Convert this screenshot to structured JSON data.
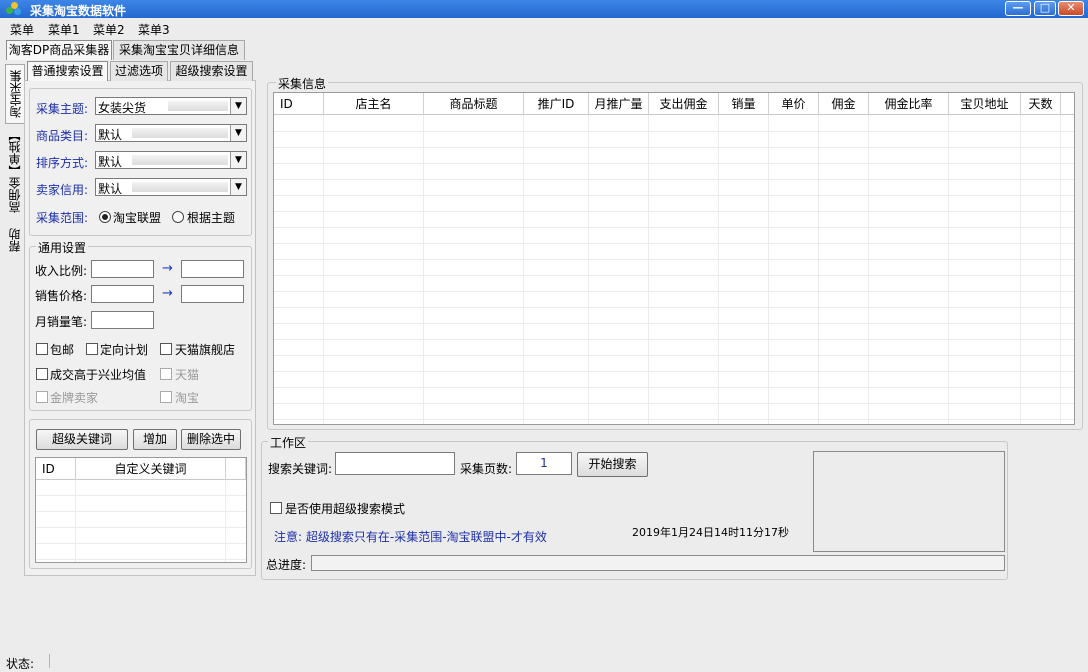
{
  "window": {
    "title": "采集淘宝数据软件",
    "min": "—",
    "max": "□",
    "close": "✕"
  },
  "menu": [
    "菜单",
    "菜单1",
    "菜单2",
    "菜单3"
  ],
  "top_tabs": [
    "淘客DP商品采集器",
    "采集淘宝宝贝详细信息"
  ],
  "vertical_tabs": [
    "淘宝采集",
    "高佣金【单独】",
    "帮助"
  ],
  "sub_tabs": [
    "普通搜索设置",
    "过滤选项",
    "超级搜索设置"
  ],
  "search": {
    "subject_label": "采集主题:",
    "subject_value": "女装尖货",
    "category_label": "商品类目:",
    "category_value": "默认",
    "sort_label": "排序方式:",
    "sort_value": "默认",
    "credit_label": "卖家信用:",
    "credit_value": "默认",
    "scope_label": "采集范围:",
    "scope_opt1": "淘宝联盟",
    "scope_opt2": "根据主题"
  },
  "general": {
    "title": "通用设置",
    "income_label": "收入比例:",
    "price_label": "销售价格:",
    "monthly_label": "月销量笔:",
    "arrow": "→",
    "cb_free_ship": "包邮",
    "cb_directed": "定向计划",
    "cb_tmall_flagship": "天猫旗舰店",
    "cb_above_avg": "成交高于兴业均值",
    "cb_tmall": "天猫",
    "cb_gold_seller": "金牌卖家",
    "cb_taobao": "淘宝"
  },
  "keywords": {
    "super_btn": "超级关键词",
    "add_btn": "增加",
    "delete_btn": "删除选中",
    "col_id": "ID",
    "col_custom": "自定义关键词"
  },
  "collect": {
    "title": "采集信息",
    "columns": [
      "ID",
      "店主名",
      "商品标题",
      "推广ID",
      "月推广量",
      "支出佣金",
      "销量",
      "单价",
      "佣金",
      "佣金比率",
      "宝贝地址",
      "天数"
    ]
  },
  "work": {
    "title": "工作区",
    "keyword_label": "搜索关键词:",
    "pages_label": "采集页数:",
    "pages_value": "1",
    "start_btn": "开始搜索",
    "super_mode": "是否使用超级搜索模式",
    "notice": "注意: 超级搜索只有在-采集范围-淘宝联盟中-才有效",
    "datetime": "2019年1月24日14时11分17秒",
    "progress_label": "总进度:",
    "progress": 0
  },
  "status": {
    "label": "状态:"
  }
}
